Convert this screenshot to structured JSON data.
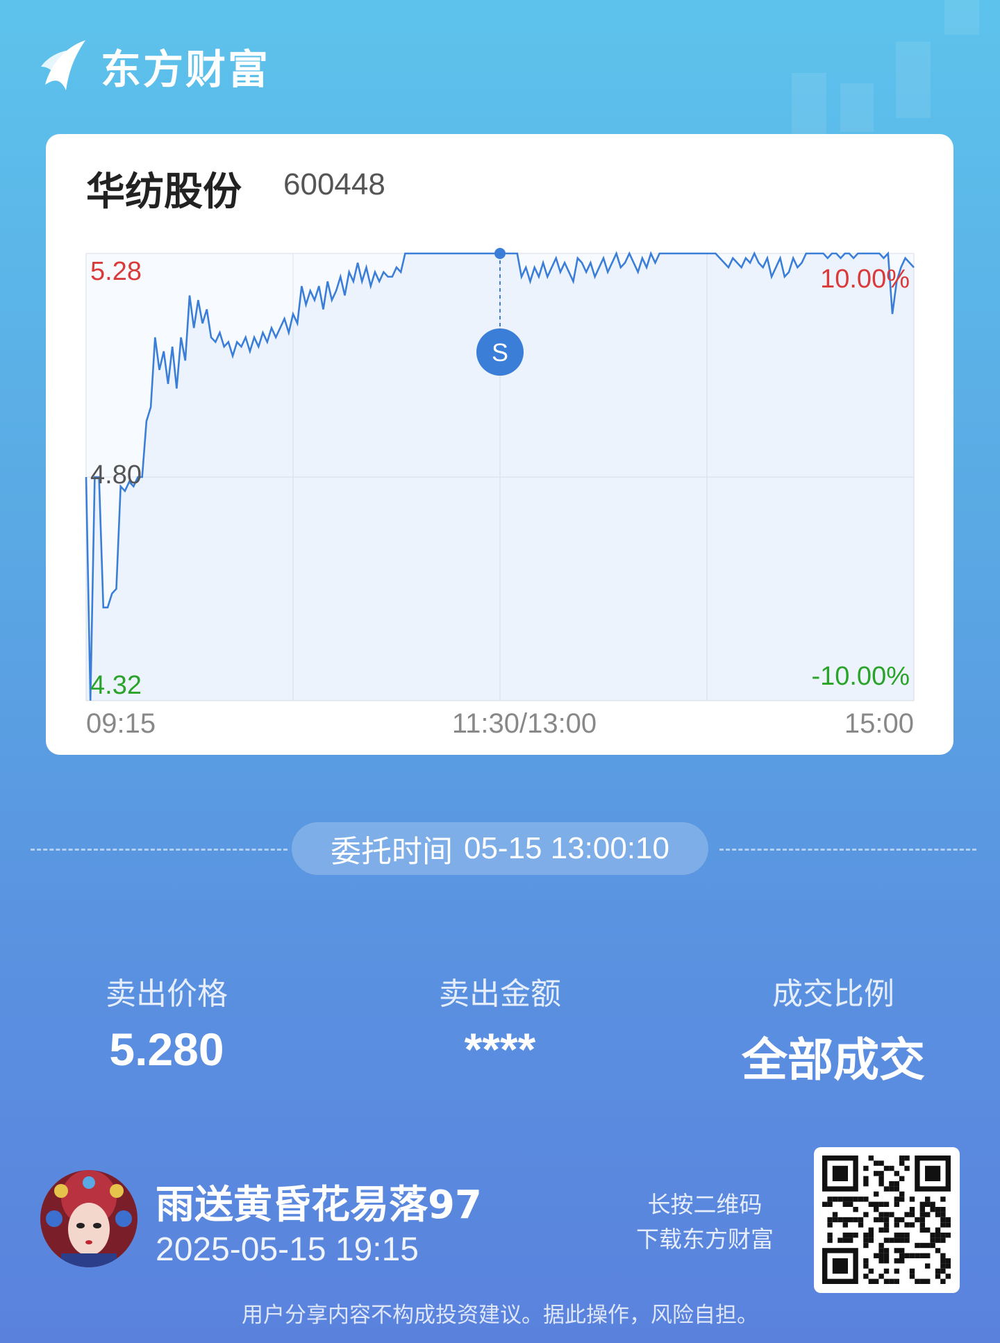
{
  "brand": {
    "name": "东方财富"
  },
  "stock": {
    "name": "华纺股份",
    "code": "600448"
  },
  "chart_data": {
    "type": "line",
    "y_ticks": {
      "top": "5.28",
      "mid": "4.80",
      "bottom": "4.32"
    },
    "pct_ticks": {
      "top": "10.00%",
      "bottom": "-10.00%"
    },
    "x_ticks": [
      "09:15",
      "11:30/13:00",
      "15:00"
    ],
    "ylim": [
      4.32,
      5.28
    ],
    "marker": {
      "label": "S",
      "time_index": 0.5,
      "price": 5.28
    },
    "series": [
      {
        "values": [
          4.8,
          4.32,
          4.8,
          4.8,
          4.52,
          4.52,
          4.55,
          4.56,
          4.78,
          4.77,
          4.79,
          4.78,
          4.8,
          4.8,
          4.92,
          4.95,
          5.1,
          5.03,
          5.07,
          5.0,
          5.08,
          4.99,
          5.1,
          5.05,
          5.19,
          5.12,
          5.18,
          5.13,
          5.16,
          5.1,
          5.09,
          5.11,
          5.08,
          5.09,
          5.06,
          5.09,
          5.08,
          5.1,
          5.07,
          5.1,
          5.08,
          5.11,
          5.09,
          5.12,
          5.1,
          5.12,
          5.14,
          5.11,
          5.15,
          5.13,
          5.21,
          5.17,
          5.2,
          5.18,
          5.21,
          5.16,
          5.22,
          5.18,
          5.2,
          5.23,
          5.19,
          5.24,
          5.22,
          5.26,
          5.22,
          5.25,
          5.21,
          5.24,
          5.22,
          5.24,
          5.23,
          5.23,
          5.25,
          5.24,
          5.28,
          5.28,
          5.28,
          5.28,
          5.28,
          5.28,
          5.28,
          5.28,
          5.28,
          5.28,
          5.28,
          5.28,
          5.28,
          5.28,
          5.28,
          5.28,
          5.28,
          5.28,
          5.28,
          5.28,
          5.28,
          5.28,
          5.28,
          5.28,
          5.28,
          5.28,
          5.28,
          5.23,
          5.25,
          5.22,
          5.25,
          5.23,
          5.26,
          5.23,
          5.25,
          5.27,
          5.24,
          5.26,
          5.24,
          5.22,
          5.27,
          5.26,
          5.24,
          5.26,
          5.23,
          5.25,
          5.27,
          5.24,
          5.26,
          5.28,
          5.25,
          5.26,
          5.28,
          5.26,
          5.24,
          5.27,
          5.25,
          5.28,
          5.26,
          5.28,
          5.28,
          5.28,
          5.28,
          5.28,
          5.28,
          5.28,
          5.28,
          5.28,
          5.28,
          5.28,
          5.28,
          5.28,
          5.28,
          5.27,
          5.26,
          5.25,
          5.27,
          5.26,
          5.25,
          5.27,
          5.26,
          5.28,
          5.26,
          5.25,
          5.27,
          5.23,
          5.25,
          5.27,
          5.23,
          5.24,
          5.27,
          5.25,
          5.26,
          5.28,
          5.28,
          5.28,
          5.28,
          5.28,
          5.27,
          5.28,
          5.28,
          5.27,
          5.28,
          5.28,
          5.27,
          5.28,
          5.28,
          5.28,
          5.28,
          5.28,
          5.28,
          5.27,
          5.28,
          5.15,
          5.22,
          5.25,
          5.27,
          5.26,
          5.25
        ]
      }
    ]
  },
  "order": {
    "label": "委托时间",
    "time": "05-15 13:00:10"
  },
  "stats": [
    {
      "label": "卖出价格",
      "value": "5.280"
    },
    {
      "label": "卖出金额",
      "value": "****"
    },
    {
      "label": "成交比例",
      "value": "全部成交"
    }
  ],
  "user": {
    "name": "雨送黄昏花易落97",
    "time": "2025-05-15 19:15"
  },
  "qr": {
    "line1": "长按二维码",
    "line2": "下载东方财富"
  },
  "disclaimer": "用户分享内容不构成投资建议。据此操作，风险自担。",
  "colors": {
    "up": "#d93a3a",
    "down": "#2aa32a",
    "line": "#3a7ed8",
    "marker": "#3a7ed8"
  }
}
